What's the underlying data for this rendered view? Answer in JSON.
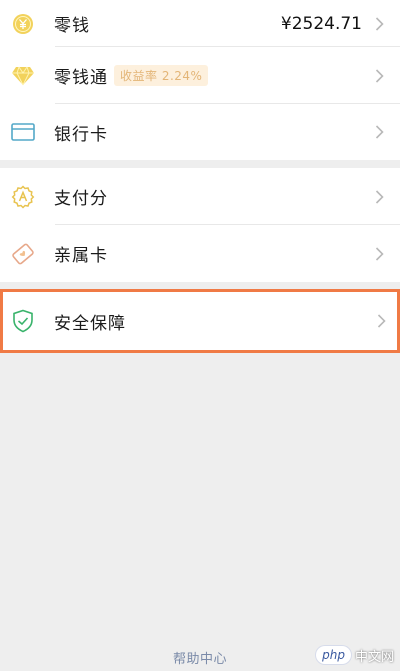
{
  "wallet": {
    "items": [
      {
        "icon": "yuan-coin-icon",
        "label": "零钱",
        "value": "¥2524.71"
      },
      {
        "icon": "diamond-icon",
        "label": "零钱通",
        "badge": "收益率 2.24%"
      },
      {
        "icon": "bank-card-icon",
        "label": "银行卡"
      }
    ],
    "services": [
      {
        "icon": "pay-score-icon",
        "label": "支付分"
      },
      {
        "icon": "family-card-icon",
        "label": "亲属卡"
      }
    ],
    "security": {
      "icon": "shield-check-icon",
      "label": "安全保障"
    }
  },
  "footer": {
    "help_center": "帮助中心"
  },
  "watermark": {
    "logo_text": "php",
    "site_text": "中文网"
  },
  "colors": {
    "accent_gold": "#e8c34f",
    "green_shield": "#39b36b",
    "bank_blue": "#53a8c8",
    "highlight_border": "#f07a45",
    "badge_bg": "#fdf0dd",
    "badge_text": "#e3b577",
    "footer_link": "#7a8aa8"
  }
}
